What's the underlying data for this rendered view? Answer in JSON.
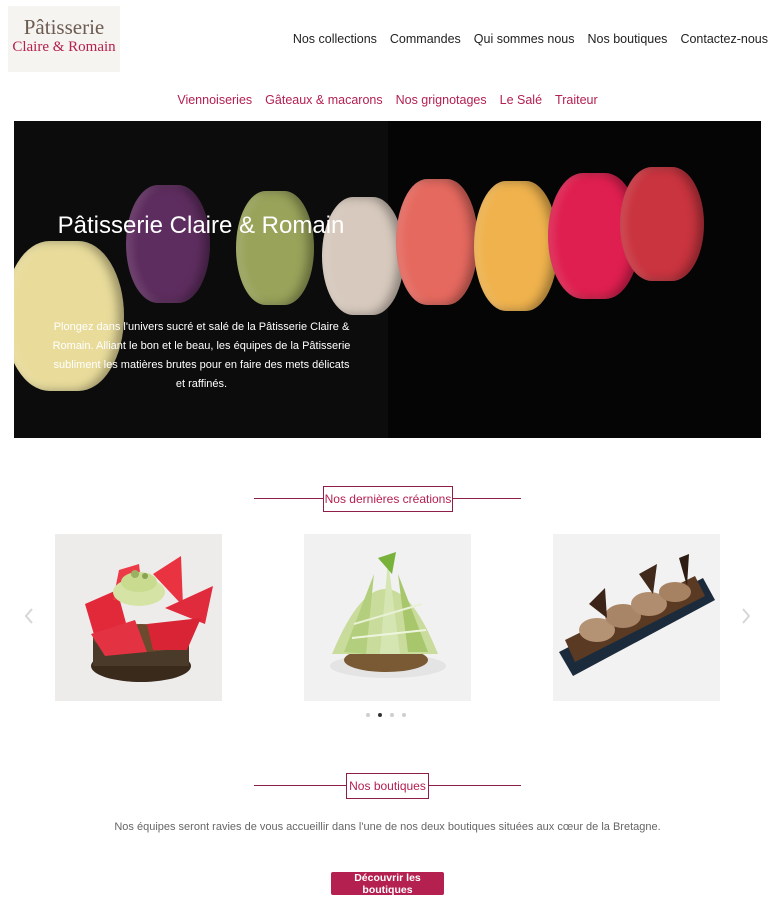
{
  "logo": {
    "line1": "Pâtisserie",
    "line2": "Claire & Romain"
  },
  "nav": {
    "main": [
      "Nos collections",
      "Commandes",
      "Qui sommes nous",
      "Nos boutiques",
      "Contactez-nous"
    ],
    "sub": [
      "Viennoiseries",
      "Gâteaux & macarons",
      "Nos grignotages",
      "Le Salé",
      "Traiteur"
    ]
  },
  "hero": {
    "title": "Pâtisserie Claire & Romain",
    "text": "Plongez dans l'univers sucré et salé de la Pâtisserie Claire & Romain. Alliant le bon et le beau, les équipes de la Pâtisserie subliment les matières brutes pour en faire des mets délicats et raffinés."
  },
  "creations": {
    "heading": "Nos dernières créations",
    "items": [
      "strawberry-tart-image",
      "green-apple-dessert-image",
      "praline-eclair-image"
    ],
    "prev_icon": "chevron-left-icon",
    "next_icon": "chevron-right-icon",
    "dots_count": 4,
    "active_dot": 2
  },
  "boutiques": {
    "heading": "Nos boutiques",
    "text": "Nos équipes seront ravies de vous accueillir dans l'une de nos deux boutiques situées aux cœur de la Bretagne.",
    "button": "Découvrir les boutiques"
  },
  "colors": {
    "accent": "#b4204f",
    "accent_dark": "#8e1d47",
    "text": "#333333"
  }
}
